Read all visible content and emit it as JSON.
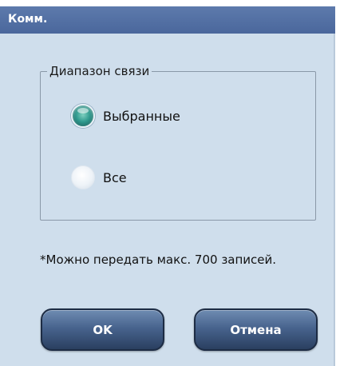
{
  "dialog": {
    "title": "Комм."
  },
  "range_group": {
    "legend": "Диапазон связи",
    "options": [
      {
        "label": "Выбранные",
        "checked": true
      },
      {
        "label": "Все",
        "checked": false
      }
    ]
  },
  "note": "*Можно передать макс. 700 записей.",
  "buttons": {
    "ok_label": "OK",
    "cancel_label": "Отмена"
  },
  "colors": {
    "titlebar": "#4f6da0",
    "background": "#cfdeec",
    "button": "#3a5478",
    "radio_checked": "#2f9a8e"
  }
}
